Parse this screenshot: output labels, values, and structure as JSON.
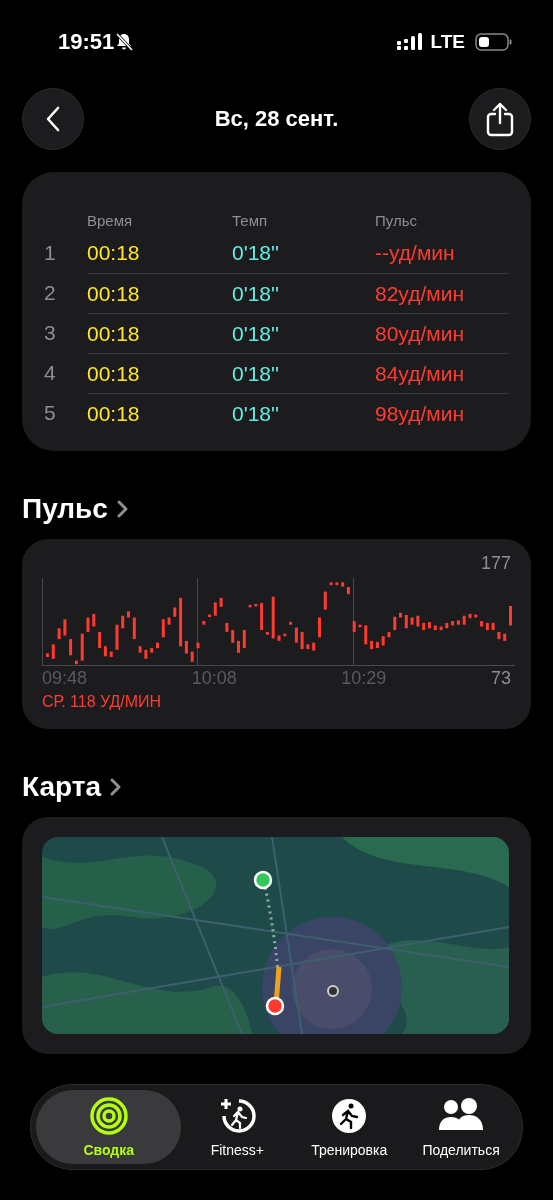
{
  "status_bar": {
    "time": "19:51",
    "network": "LTE"
  },
  "header": {
    "title": "Вс, 28 сент."
  },
  "splits": {
    "columns": [
      "Время",
      "Темп",
      "Пульс"
    ],
    "rows": [
      {
        "index": "1",
        "time": "00:18",
        "pace": "0'18''",
        "pulse": "--уд/мин"
      },
      {
        "index": "2",
        "time": "00:18",
        "pace": "0'18''",
        "pulse": "82уд/мин"
      },
      {
        "index": "3",
        "time": "00:18",
        "pace": "0'18''",
        "pulse": "80уд/мин"
      },
      {
        "index": "4",
        "time": "00:18",
        "pace": "0'18''",
        "pulse": "84уд/мин"
      },
      {
        "index": "5",
        "time": "00:18",
        "pace": "0'18''",
        "pulse": "98уд/мин"
      }
    ]
  },
  "heart_rate": {
    "heading": "Пульс",
    "max_label": "177",
    "min_label": "73",
    "time_labels": [
      "09:48",
      "10:08",
      "10:29"
    ],
    "average": "СР. 118 УД/МИН"
  },
  "map": {
    "heading": "Карта",
    "kind": "picture"
  },
  "tabs": [
    {
      "label": "Сводка",
      "kind": "summary",
      "selected": true
    },
    {
      "label": "Fitness+",
      "kind": "fitness",
      "selected": false
    },
    {
      "label": "Тренировка",
      "kind": "workout",
      "selected": false
    },
    {
      "label": "Поделиться",
      "kind": "share",
      "selected": false
    }
  ]
}
